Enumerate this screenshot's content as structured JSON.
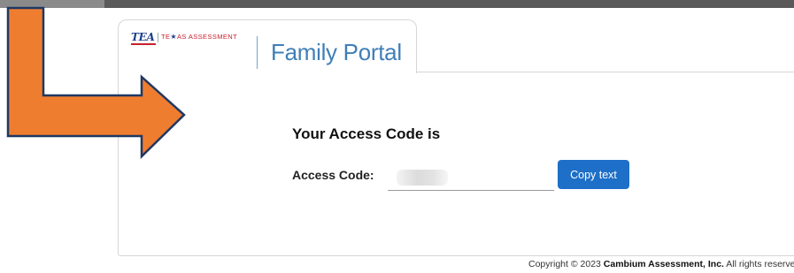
{
  "header": {
    "tea_logo_text": "TEA",
    "texas_part1": "TE",
    "texas_star": "★",
    "texas_part2": "AS ASSESSMENT",
    "portal_title": "Family Portal"
  },
  "main": {
    "heading": "Your Access Code is",
    "code_label": "Access Code:",
    "code_value": "",
    "copy_button": "Copy text"
  },
  "footer": {
    "copyright_prefix": "Copyright © 2023 ",
    "company": "Cambium Assessment, Inc.",
    "copyright_suffix": " All rights reserved"
  },
  "annotation": {
    "arrow_color": "#ef7d30",
    "arrow_outline": "#1f3864",
    "arrow_icon": "elbow-arrow-icon"
  },
  "colors": {
    "accent": "#1d6fc7",
    "portal_title": "#3f7fb8",
    "brand_red": "#c8202b",
    "brand_blue": "#1e3f8c"
  }
}
